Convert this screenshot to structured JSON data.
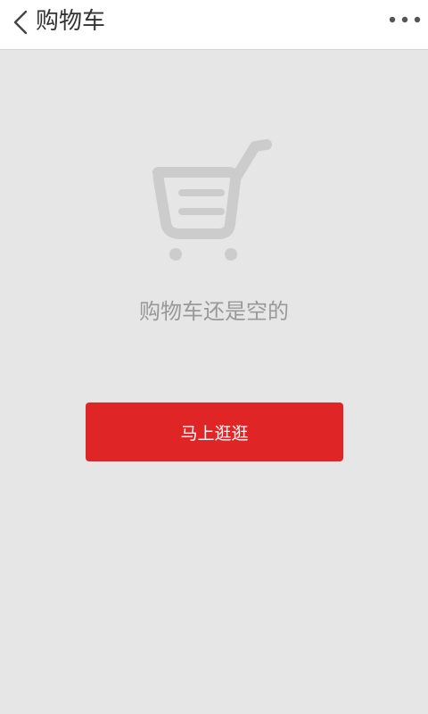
{
  "header": {
    "title": "购物车",
    "back_icon": "chevron-left-icon",
    "more_icon": "more-dots-icon"
  },
  "empty_state": {
    "icon": "shopping-cart-icon",
    "message": "购物车还是空的",
    "button_label": "马上逛逛"
  },
  "colors": {
    "background": "#e6e6e6",
    "header_background": "#ffffff",
    "accent": "#df2526",
    "icon_gray": "#cccccc",
    "text_gray": "#999999"
  }
}
